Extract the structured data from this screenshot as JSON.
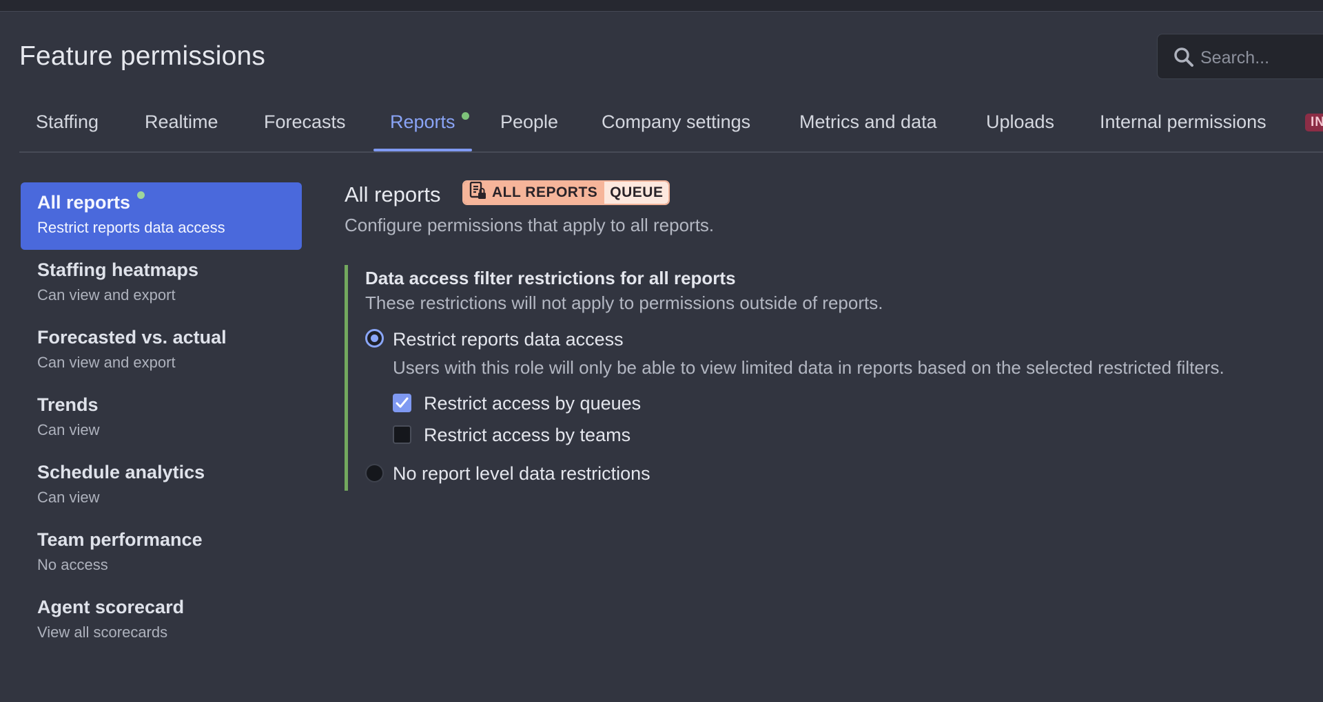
{
  "page": {
    "title": "Feature permissions"
  },
  "search": {
    "placeholder": "Search..."
  },
  "tabs": [
    {
      "label": "Staffing",
      "active": false
    },
    {
      "label": "Realtime",
      "active": false
    },
    {
      "label": "Forecasts",
      "active": false
    },
    {
      "label": "Reports",
      "active": true,
      "has_dot": true
    },
    {
      "label": "People",
      "active": false
    },
    {
      "label": "Company settings",
      "active": false
    },
    {
      "label": "Metrics and data",
      "active": false
    },
    {
      "label": "Uploads",
      "active": false
    },
    {
      "label": "Internal permissions",
      "active": false,
      "badge": "INTE"
    }
  ],
  "sidebar": {
    "items": [
      {
        "title": "All reports",
        "subtitle": "Restrict reports data access",
        "active": true,
        "has_dot": true
      },
      {
        "title": "Staffing heatmaps",
        "subtitle": "Can view and export"
      },
      {
        "title": "Forecasted vs. actual",
        "subtitle": "Can view and export"
      },
      {
        "title": "Trends",
        "subtitle": "Can view"
      },
      {
        "title": "Schedule analytics",
        "subtitle": "Can view"
      },
      {
        "title": "Team performance",
        "subtitle": "No access"
      },
      {
        "title": "Agent scorecard",
        "subtitle": "View all scorecards"
      }
    ]
  },
  "main": {
    "title": "All reports",
    "badge_left": "ALL REPORTS",
    "badge_right": "QUEUE",
    "description": "Configure permissions that apply to all reports.",
    "section": {
      "title": "Data access filter restrictions for all reports",
      "description": "These restrictions will not apply to permissions outside of reports.",
      "options": [
        {
          "label": "Restrict reports data access",
          "description": "Users with this role will only be able to view limited data in reports based on the selected restricted filters.",
          "selected": true,
          "checks": [
            {
              "label": "Restrict access by queues",
              "checked": true
            },
            {
              "label": "Restrict access by teams",
              "checked": false
            }
          ]
        },
        {
          "label": "No report level data restrictions",
          "selected": false
        }
      ]
    }
  },
  "colors": {
    "background": "#323540",
    "accent": "#7f99f2",
    "active_sidebar": "#4a69dc",
    "dot_green": "#7ec27a",
    "section_border": "#73a85e",
    "badge_salmon": "#f6b59a",
    "internal_badge": "#8c2d46"
  },
  "icons": {
    "search": "search-icon",
    "report_lock": "report-lock-icon",
    "check": "checkmark-icon"
  }
}
